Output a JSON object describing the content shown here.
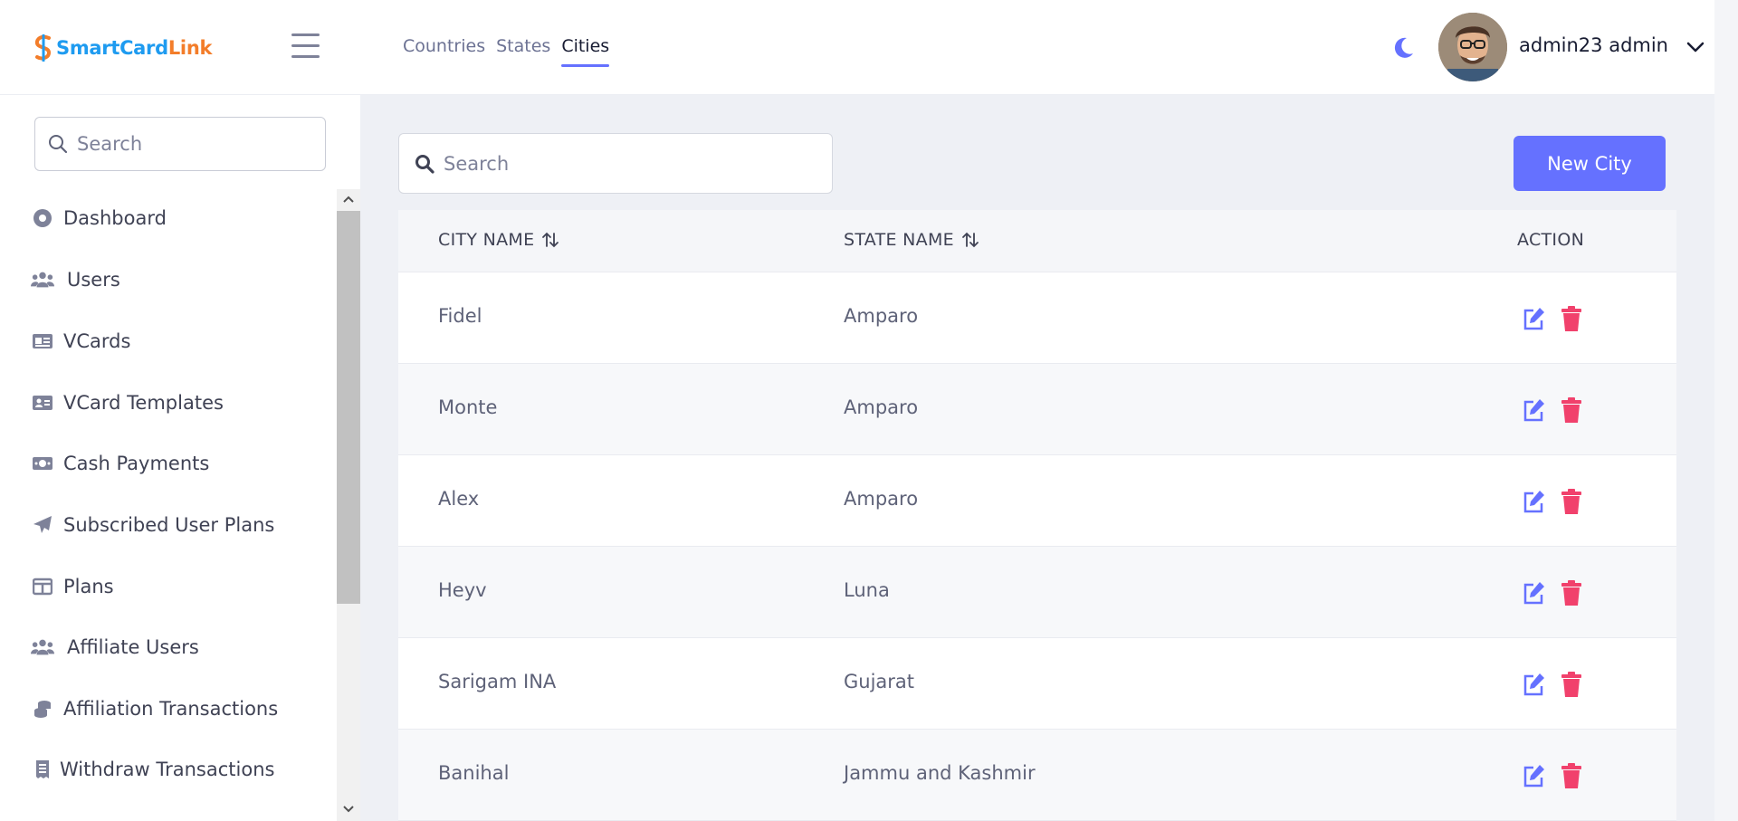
{
  "brand": {
    "name_part1": "SmartCard",
    "name_part2": "Link"
  },
  "top_nav": [
    {
      "label": "Countries"
    },
    {
      "label": "States"
    },
    {
      "label": "Cities"
    }
  ],
  "user": {
    "name": "admin23 admin"
  },
  "sidebar": {
    "search_placeholder": "Search",
    "items": [
      {
        "label": "Dashboard",
        "icon": "dashboard-icon"
      },
      {
        "label": "Users",
        "icon": "users-icon"
      },
      {
        "label": "VCards",
        "icon": "vcards-icon"
      },
      {
        "label": "VCard Templates",
        "icon": "id-card-icon"
      },
      {
        "label": "Cash Payments",
        "icon": "money-icon"
      },
      {
        "label": "Subscribed User Plans",
        "icon": "paper-plane-icon"
      },
      {
        "label": "Plans",
        "icon": "table-icon"
      },
      {
        "label": "Affiliate Users",
        "icon": "users-icon"
      },
      {
        "label": "Affiliation Transactions",
        "icon": "coins-icon"
      },
      {
        "label": "Withdraw Transactions",
        "icon": "receipt-icon"
      }
    ]
  },
  "main": {
    "search_placeholder": "Search",
    "new_button": "New City",
    "columns": {
      "city": "CITY NAME",
      "state": "STATE NAME",
      "action": "ACTION"
    },
    "rows": [
      {
        "city": "Fidel",
        "state": "Amparo"
      },
      {
        "city": "Monte",
        "state": "Amparo"
      },
      {
        "city": "Alex",
        "state": "Amparo"
      },
      {
        "city": "Heyv",
        "state": "Luna"
      },
      {
        "city": "Sarigam INA",
        "state": "Gujarat"
      },
      {
        "city": "Banihal",
        "state": "Jammu and Kashmir"
      }
    ]
  },
  "colors": {
    "accent": "#6571ff",
    "danger": "#f1416c"
  }
}
